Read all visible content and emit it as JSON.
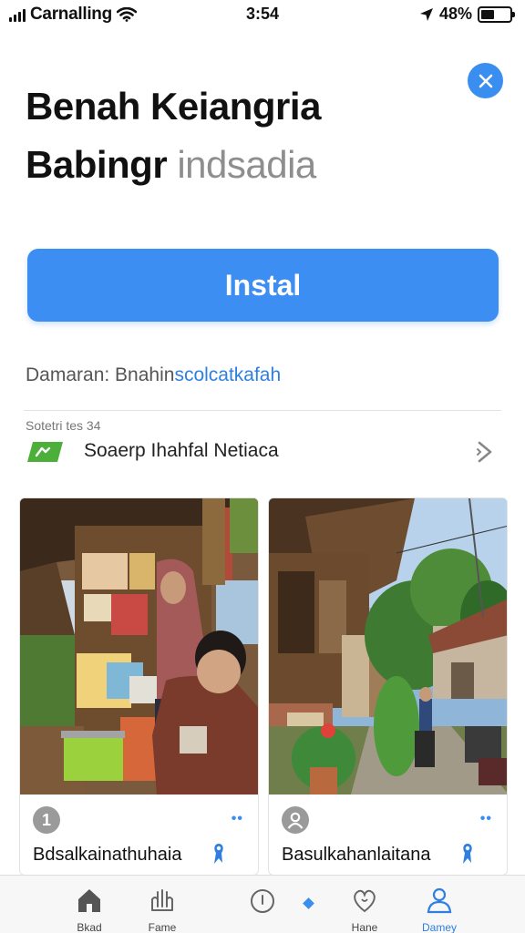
{
  "status_bar": {
    "carrier": "Carnalling",
    "time": "3:54",
    "battery": "48%",
    "battery_level": 0.48
  },
  "app": {
    "title_line1": "Benah Keiangria",
    "title_line2_main": "Babingr",
    "title_line2_faded": " indsadia",
    "install_label": "Instal",
    "domain_prefix": "Damaran: ",
    "domain_main": "Bnahin",
    "domain_link": "scolcatkafah"
  },
  "category": {
    "section_label": "Sotetri tes 34",
    "label": "Soaerp Ihahfal Netiaca",
    "icon": "tag-icon",
    "chevron": "chevron-right-icon"
  },
  "cards": [
    {
      "badge": "1",
      "caption": "Bdsalkainathuhaia",
      "more": "••",
      "pin_icon": "map-pin-icon"
    },
    {
      "badge": "",
      "caption": "Basulkahanlaitana",
      "more": "••",
      "pin_icon": "map-pin-icon"
    }
  ],
  "tab_bar": {
    "tabs": [
      {
        "label": "Bkad",
        "icon": "home-icon"
      },
      {
        "label": "Fame",
        "icon": "hands-icon"
      },
      {
        "label": "",
        "icon": "compass-icon"
      },
      {
        "label": "Hane",
        "icon": "heart-icon"
      },
      {
        "label": "Damey",
        "icon": "person-icon",
        "active": true
      }
    ]
  },
  "colors": {
    "accent": "#3c8ef2",
    "link": "#2f7fe0",
    "category_icon": "#4caf3a"
  }
}
